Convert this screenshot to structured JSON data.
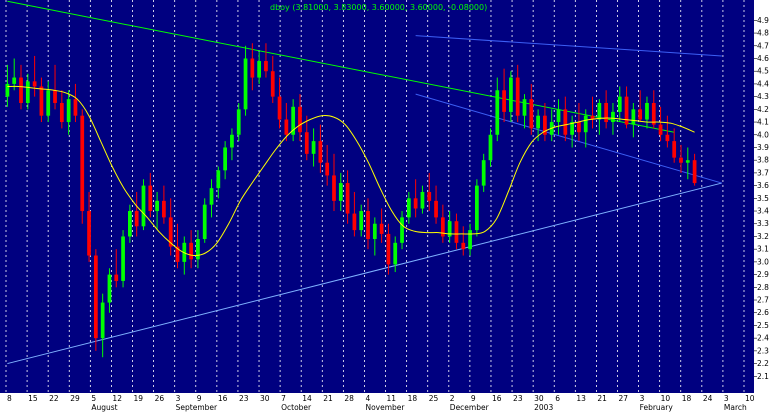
{
  "chart_data": {
    "type": "candlestick",
    "legend": "dboy (3.81000, 3.83000, 3.60000, 3.60000, -0.08000)",
    "colors": {
      "background": "#000080",
      "up_candle": "#00ff00",
      "down_candle": "#ff0000",
      "moving_average": "#ffff00",
      "trendline_green": "#00ff00",
      "trendline_blue": "#3c5ff5",
      "support_line": "#7fb2ff",
      "grid": "#ffffff",
      "axis_panel": "#ffffff"
    },
    "ylim": [
      2.0,
      4.95
    ],
    "y_ticks": [
      "2.1",
      "2.2",
      "2.3",
      "2.4",
      "2.5",
      "2.6",
      "2.7",
      "2.8",
      "2.9",
      "3.0",
      "3.1",
      "3.2",
      "3.3",
      "3.4",
      "3.5",
      "3.6",
      "3.7",
      "3.8",
      "3.9",
      "4.0",
      "4.1",
      "4.2",
      "4.3",
      "4.4",
      "4.5",
      "4.6",
      "4.7",
      "4.8",
      "4.9"
    ],
    "x_ticks": [
      "8",
      "15",
      "22",
      "29",
      "5",
      "12",
      "19",
      "26",
      "3",
      "9",
      "16",
      "23",
      "30",
      "7",
      "14",
      "21",
      "28",
      "4",
      "11",
      "18",
      "25",
      "2",
      "9",
      "16",
      "23",
      "30",
      "6",
      "13",
      "21",
      "27",
      "3",
      "10",
      "18",
      "24",
      "3",
      "10"
    ],
    "x_months": [
      "August",
      "September",
      "October",
      "November",
      "December",
      "2003",
      "February",
      "March"
    ],
    "candles": [
      [
        4.3,
        4.55,
        4.22,
        4.4
      ],
      [
        4.4,
        4.6,
        4.35,
        4.45
      ],
      [
        4.45,
        4.55,
        4.2,
        4.25
      ],
      [
        4.25,
        4.48,
        4.2,
        4.42
      ],
      [
        4.42,
        4.62,
        4.3,
        4.38
      ],
      [
        4.38,
        4.45,
        4.1,
        4.15
      ],
      [
        4.15,
        4.42,
        4.1,
        4.35
      ],
      [
        4.35,
        4.55,
        4.2,
        4.25
      ],
      [
        4.25,
        4.35,
        4.05,
        4.1
      ],
      [
        4.1,
        4.35,
        4.0,
        4.28
      ],
      [
        4.28,
        4.4,
        4.1,
        4.15
      ],
      [
        4.15,
        4.2,
        3.3,
        3.4
      ],
      [
        3.4,
        3.55,
        3.0,
        3.05
      ],
      [
        3.05,
        3.1,
        2.3,
        2.4
      ],
      [
        2.4,
        2.75,
        2.25,
        2.68
      ],
      [
        2.68,
        2.95,
        2.6,
        2.9
      ],
      [
        2.9,
        3.1,
        2.8,
        2.85
      ],
      [
        2.85,
        3.25,
        2.8,
        3.2
      ],
      [
        3.2,
        3.45,
        3.15,
        3.4
      ],
      [
        3.4,
        3.55,
        3.2,
        3.28
      ],
      [
        3.28,
        3.65,
        3.25,
        3.6
      ],
      [
        3.6,
        3.7,
        3.35,
        3.4
      ],
      [
        3.4,
        3.55,
        3.25,
        3.48
      ],
      [
        3.48,
        3.6,
        3.3,
        3.35
      ],
      [
        3.35,
        3.5,
        3.05,
        3.12
      ],
      [
        3.12,
        3.3,
        2.95,
        3.0
      ],
      [
        3.0,
        3.2,
        2.9,
        3.15
      ],
      [
        3.15,
        3.25,
        2.95,
        3.02
      ],
      [
        3.02,
        3.25,
        2.95,
        3.18
      ],
      [
        3.18,
        3.5,
        3.15,
        3.45
      ],
      [
        3.45,
        3.65,
        3.35,
        3.58
      ],
      [
        3.58,
        3.75,
        3.5,
        3.72
      ],
      [
        3.72,
        3.95,
        3.65,
        3.9
      ],
      [
        3.9,
        4.05,
        3.8,
        4.0
      ],
      [
        4.0,
        4.25,
        3.95,
        4.2
      ],
      [
        4.2,
        4.7,
        4.15,
        4.6
      ],
      [
        4.6,
        4.72,
        4.35,
        4.45
      ],
      [
        4.45,
        4.65,
        4.4,
        4.58
      ],
      [
        4.58,
        4.72,
        4.45,
        4.5
      ],
      [
        4.5,
        4.62,
        4.25,
        4.3
      ],
      [
        4.3,
        4.45,
        4.05,
        4.12
      ],
      [
        4.12,
        4.25,
        3.95,
        4.0
      ],
      [
        4.0,
        4.28,
        3.95,
        4.22
      ],
      [
        4.22,
        4.32,
        3.95,
        4.02
      ],
      [
        4.02,
        4.15,
        3.8,
        3.85
      ],
      [
        3.85,
        4.05,
        3.75,
        3.95
      ],
      [
        3.95,
        4.08,
        3.7,
        3.78
      ],
      [
        3.78,
        3.92,
        3.6,
        3.68
      ],
      [
        3.68,
        3.85,
        3.4,
        3.48
      ],
      [
        3.48,
        3.7,
        3.4,
        3.62
      ],
      [
        3.62,
        3.72,
        3.3,
        3.38
      ],
      [
        3.38,
        3.55,
        3.2,
        3.25
      ],
      [
        3.25,
        3.45,
        3.2,
        3.4
      ],
      [
        3.4,
        3.5,
        3.1,
        3.18
      ],
      [
        3.18,
        3.35,
        3.05,
        3.3
      ],
      [
        3.3,
        3.42,
        3.15,
        3.22
      ],
      [
        3.22,
        3.3,
        2.9,
        2.98
      ],
      [
        2.98,
        3.2,
        2.92,
        3.15
      ],
      [
        3.15,
        3.4,
        3.1,
        3.35
      ],
      [
        3.35,
        3.55,
        3.3,
        3.5
      ],
      [
        3.5,
        3.65,
        3.35,
        3.42
      ],
      [
        3.42,
        3.6,
        3.38,
        3.55
      ],
      [
        3.55,
        3.7,
        3.4,
        3.48
      ],
      [
        3.48,
        3.6,
        3.3,
        3.35
      ],
      [
        3.35,
        3.45,
        3.15,
        3.2
      ],
      [
        3.2,
        3.4,
        3.15,
        3.32
      ],
      [
        3.32,
        3.38,
        3.1,
        3.15
      ],
      [
        3.15,
        3.28,
        3.05,
        3.1
      ],
      [
        3.1,
        3.3,
        3.05,
        3.25
      ],
      [
        3.25,
        3.65,
        3.2,
        3.6
      ],
      [
        3.6,
        3.85,
        3.55,
        3.8
      ],
      [
        3.8,
        4.05,
        3.75,
        4.0
      ],
      [
        4.0,
        4.45,
        3.95,
        4.35
      ],
      [
        4.35,
        4.52,
        4.1,
        4.18
      ],
      [
        4.18,
        4.5,
        4.1,
        4.45
      ],
      [
        4.45,
        4.55,
        4.1,
        4.15
      ],
      [
        4.15,
        4.32,
        4.05,
        4.28
      ],
      [
        4.28,
        4.4,
        4.0,
        4.05
      ],
      [
        4.05,
        4.2,
        3.95,
        4.15
      ],
      [
        4.15,
        4.25,
        3.95,
        4.0
      ],
      [
        4.0,
        4.2,
        3.95,
        4.1
      ],
      [
        4.1,
        4.28,
        4.0,
        4.2
      ],
      [
        4.2,
        4.3,
        3.95,
        4.0
      ],
      [
        4.0,
        4.15,
        3.9,
        4.1
      ],
      [
        4.1,
        4.25,
        3.95,
        4.02
      ],
      [
        4.02,
        4.2,
        3.9,
        4.15
      ],
      [
        4.15,
        4.3,
        4.05,
        4.12
      ],
      [
        4.12,
        4.28,
        4.0,
        4.25
      ],
      [
        4.25,
        4.35,
        4.05,
        4.1
      ],
      [
        4.1,
        4.25,
        4.0,
        4.18
      ],
      [
        4.18,
        4.38,
        4.1,
        4.3
      ],
      [
        4.3,
        4.38,
        4.05,
        4.08
      ],
      [
        4.08,
        4.25,
        3.98,
        4.2
      ],
      [
        4.2,
        4.35,
        4.1,
        4.12
      ],
      [
        4.12,
        4.3,
        4.05,
        4.25
      ],
      [
        4.25,
        4.35,
        4.05,
        4.08
      ],
      [
        4.08,
        4.22,
        3.95,
        4.0
      ],
      [
        4.0,
        4.15,
        3.9,
        3.95
      ],
      [
        3.95,
        4.05,
        3.78,
        3.82
      ],
      [
        3.82,
        3.92,
        3.7,
        3.78
      ],
      [
        3.78,
        3.9,
        3.65,
        3.8
      ],
      [
        3.8,
        3.85,
        3.6,
        3.62
      ]
    ],
    "moving_average": [
      4.38,
      4.38,
      4.37,
      4.36,
      4.35,
      4.33,
      4.28,
      4.15,
      3.95,
      3.75,
      3.58,
      3.45,
      3.35,
      3.24,
      3.15,
      3.08,
      3.05,
      3.07,
      3.15,
      3.3,
      3.48,
      3.62,
      3.75,
      3.88,
      3.99,
      4.07,
      4.12,
      4.15,
      4.14,
      4.08,
      3.95,
      3.78,
      3.58,
      3.4,
      3.28,
      3.24,
      3.23,
      3.23,
      3.22,
      3.22,
      3.22,
      3.24,
      3.34,
      3.55,
      3.78,
      3.94,
      4.02,
      4.06,
      4.08,
      4.1,
      4.12,
      4.13,
      4.13,
      4.12,
      4.11,
      4.1,
      4.1,
      4.09,
      4.06,
      4.02
    ],
    "trendlines": [
      {
        "points": [
          [
            0,
            5.05
          ],
          [
            98,
            4.02
          ]
        ],
        "color": "green"
      },
      {
        "points": [
          [
            0,
            2.2
          ],
          [
            105,
            3.62
          ]
        ],
        "color": "support"
      },
      {
        "points": [
          [
            60,
            4.78
          ],
          [
            105,
            4.62
          ]
        ],
        "color": "blue"
      },
      {
        "points": [
          [
            60,
            4.32
          ],
          [
            105,
            3.62
          ]
        ],
        "color": "blue"
      }
    ]
  }
}
